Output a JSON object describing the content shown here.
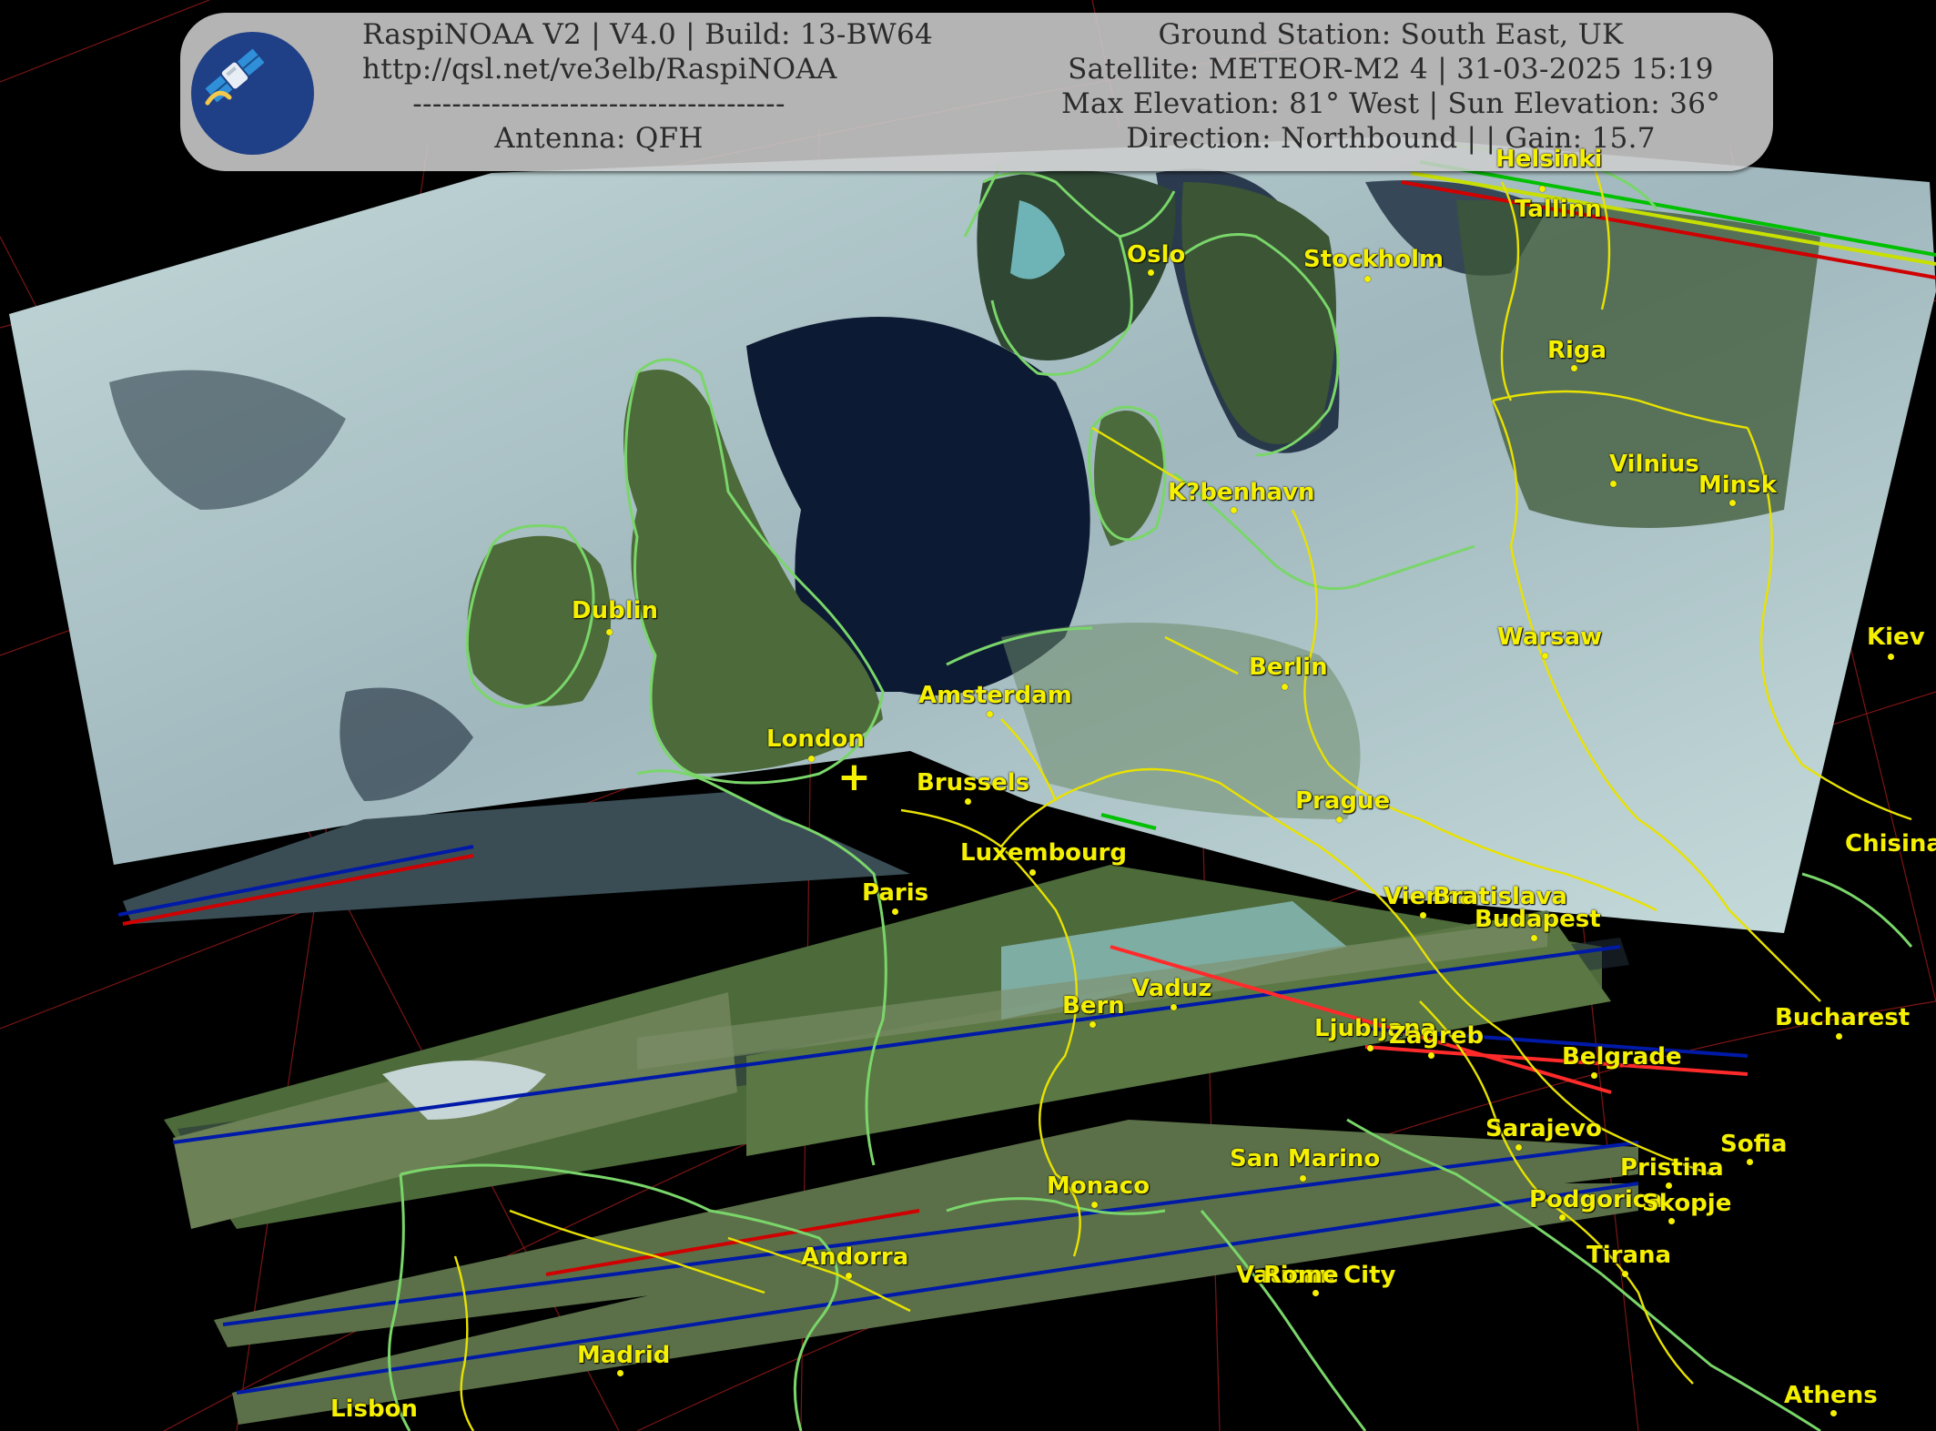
{
  "header": {
    "left": {
      "line1": "RaspiNOAA V2 | V4.0 | Build: 13-BW64",
      "line2": "http://qsl.net/ve3elb/RaspiNOAA",
      "line3": "--------------------------------------",
      "line4": "Antenna: QFH"
    },
    "right": {
      "line1": "Ground Station: South East, UK",
      "line2": "Satellite: METEOR-M2 4 | 31-03-2025 15:19",
      "line3": "Max Elevation: 81° West | Sun Elevation: 36°",
      "line4": "Direction: Northbound | | Gain: 15.7"
    }
  },
  "logo": {
    "icon": "satellite-icon"
  },
  "ground_station_marker": {
    "glyph": "+"
  },
  "cities": [
    "Helsinki",
    "Tallinn",
    "Oslo",
    "Stockholm",
    "Riga",
    "Vilnius",
    "Minsk",
    "K?benhavn",
    "Dublin",
    "Amsterdam",
    "London",
    "Berlin",
    "Warsaw",
    "Kiev",
    "Brussels",
    "Prague",
    "Luxembourg",
    "Paris",
    "Chisinau",
    "Vienna",
    "Bratislava",
    "Budapest",
    "Vaduz",
    "Bern",
    "Ljubljana",
    "Zagreb",
    "Bucharest",
    "Belgrade",
    "Sarajevo",
    "Sofia",
    "San Marino",
    "Pristina",
    "Monaco",
    "Podgorica",
    "Skopje",
    "Andorra",
    "Tirana",
    "Vatican City",
    "Rome",
    "Madrid",
    "Lisbon",
    "Athens"
  ],
  "colors": {
    "city_label": "#f5f000",
    "coastline": "#7ad66a",
    "border": "#e8e200",
    "graticule": "#8a1818",
    "cloud": "#c9dedc",
    "sea": "#0d1a33",
    "land": "#4d6a3a"
  }
}
